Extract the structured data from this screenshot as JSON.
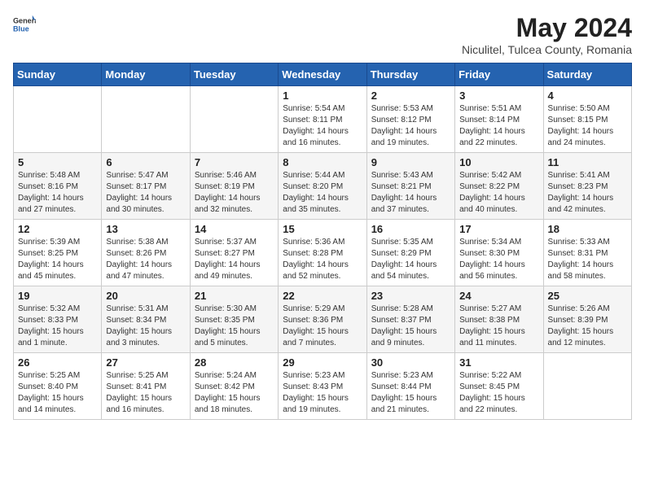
{
  "header": {
    "logo_general": "General",
    "logo_blue": "Blue",
    "month_year": "May 2024",
    "location": "Niculitel, Tulcea County, Romania"
  },
  "weekdays": [
    "Sunday",
    "Monday",
    "Tuesday",
    "Wednesday",
    "Thursday",
    "Friday",
    "Saturday"
  ],
  "weeks": [
    [
      {
        "day": "",
        "info": ""
      },
      {
        "day": "",
        "info": ""
      },
      {
        "day": "",
        "info": ""
      },
      {
        "day": "1",
        "info": "Sunrise: 5:54 AM\nSunset: 8:11 PM\nDaylight: 14 hours and 16 minutes."
      },
      {
        "day": "2",
        "info": "Sunrise: 5:53 AM\nSunset: 8:12 PM\nDaylight: 14 hours and 19 minutes."
      },
      {
        "day": "3",
        "info": "Sunrise: 5:51 AM\nSunset: 8:14 PM\nDaylight: 14 hours and 22 minutes."
      },
      {
        "day": "4",
        "info": "Sunrise: 5:50 AM\nSunset: 8:15 PM\nDaylight: 14 hours and 24 minutes."
      }
    ],
    [
      {
        "day": "5",
        "info": "Sunrise: 5:48 AM\nSunset: 8:16 PM\nDaylight: 14 hours and 27 minutes."
      },
      {
        "day": "6",
        "info": "Sunrise: 5:47 AM\nSunset: 8:17 PM\nDaylight: 14 hours and 30 minutes."
      },
      {
        "day": "7",
        "info": "Sunrise: 5:46 AM\nSunset: 8:19 PM\nDaylight: 14 hours and 32 minutes."
      },
      {
        "day": "8",
        "info": "Sunrise: 5:44 AM\nSunset: 8:20 PM\nDaylight: 14 hours and 35 minutes."
      },
      {
        "day": "9",
        "info": "Sunrise: 5:43 AM\nSunset: 8:21 PM\nDaylight: 14 hours and 37 minutes."
      },
      {
        "day": "10",
        "info": "Sunrise: 5:42 AM\nSunset: 8:22 PM\nDaylight: 14 hours and 40 minutes."
      },
      {
        "day": "11",
        "info": "Sunrise: 5:41 AM\nSunset: 8:23 PM\nDaylight: 14 hours and 42 minutes."
      }
    ],
    [
      {
        "day": "12",
        "info": "Sunrise: 5:39 AM\nSunset: 8:25 PM\nDaylight: 14 hours and 45 minutes."
      },
      {
        "day": "13",
        "info": "Sunrise: 5:38 AM\nSunset: 8:26 PM\nDaylight: 14 hours and 47 minutes."
      },
      {
        "day": "14",
        "info": "Sunrise: 5:37 AM\nSunset: 8:27 PM\nDaylight: 14 hours and 49 minutes."
      },
      {
        "day": "15",
        "info": "Sunrise: 5:36 AM\nSunset: 8:28 PM\nDaylight: 14 hours and 52 minutes."
      },
      {
        "day": "16",
        "info": "Sunrise: 5:35 AM\nSunset: 8:29 PM\nDaylight: 14 hours and 54 minutes."
      },
      {
        "day": "17",
        "info": "Sunrise: 5:34 AM\nSunset: 8:30 PM\nDaylight: 14 hours and 56 minutes."
      },
      {
        "day": "18",
        "info": "Sunrise: 5:33 AM\nSunset: 8:31 PM\nDaylight: 14 hours and 58 minutes."
      }
    ],
    [
      {
        "day": "19",
        "info": "Sunrise: 5:32 AM\nSunset: 8:33 PM\nDaylight: 15 hours and 1 minute."
      },
      {
        "day": "20",
        "info": "Sunrise: 5:31 AM\nSunset: 8:34 PM\nDaylight: 15 hours and 3 minutes."
      },
      {
        "day": "21",
        "info": "Sunrise: 5:30 AM\nSunset: 8:35 PM\nDaylight: 15 hours and 5 minutes."
      },
      {
        "day": "22",
        "info": "Sunrise: 5:29 AM\nSunset: 8:36 PM\nDaylight: 15 hours and 7 minutes."
      },
      {
        "day": "23",
        "info": "Sunrise: 5:28 AM\nSunset: 8:37 PM\nDaylight: 15 hours and 9 minutes."
      },
      {
        "day": "24",
        "info": "Sunrise: 5:27 AM\nSunset: 8:38 PM\nDaylight: 15 hours and 11 minutes."
      },
      {
        "day": "25",
        "info": "Sunrise: 5:26 AM\nSunset: 8:39 PM\nDaylight: 15 hours and 12 minutes."
      }
    ],
    [
      {
        "day": "26",
        "info": "Sunrise: 5:25 AM\nSunset: 8:40 PM\nDaylight: 15 hours and 14 minutes."
      },
      {
        "day": "27",
        "info": "Sunrise: 5:25 AM\nSunset: 8:41 PM\nDaylight: 15 hours and 16 minutes."
      },
      {
        "day": "28",
        "info": "Sunrise: 5:24 AM\nSunset: 8:42 PM\nDaylight: 15 hours and 18 minutes."
      },
      {
        "day": "29",
        "info": "Sunrise: 5:23 AM\nSunset: 8:43 PM\nDaylight: 15 hours and 19 minutes."
      },
      {
        "day": "30",
        "info": "Sunrise: 5:23 AM\nSunset: 8:44 PM\nDaylight: 15 hours and 21 minutes."
      },
      {
        "day": "31",
        "info": "Sunrise: 5:22 AM\nSunset: 8:45 PM\nDaylight: 15 hours and 22 minutes."
      },
      {
        "day": "",
        "info": ""
      }
    ]
  ]
}
